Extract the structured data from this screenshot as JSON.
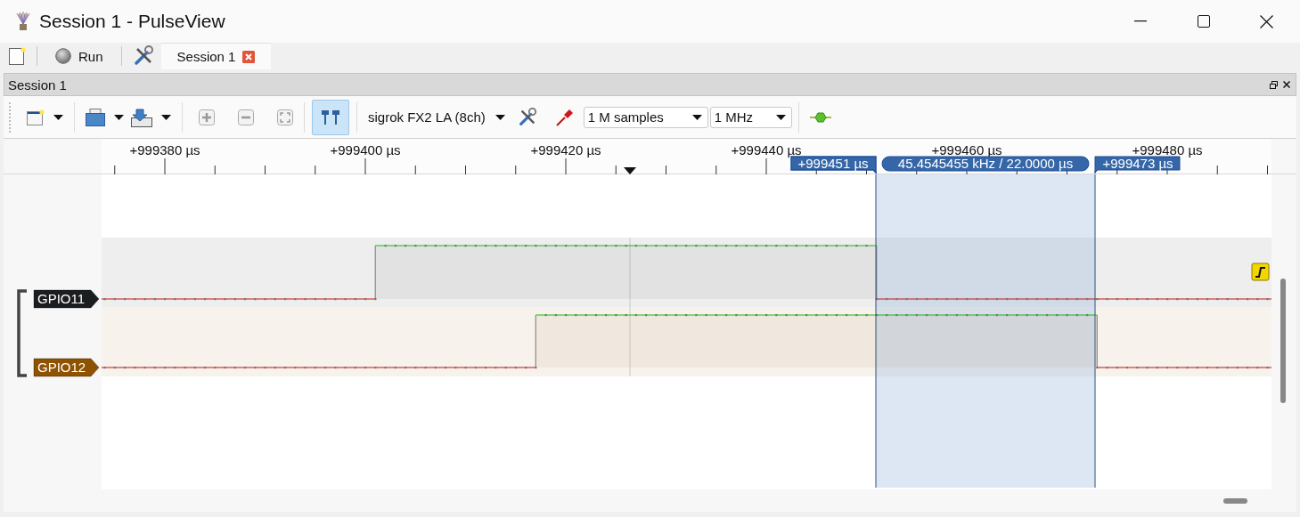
{
  "window": {
    "title": "Session 1 - PulseView"
  },
  "main_toolbar": {
    "run_button": "Run",
    "tabs": [
      {
        "label": "Session 1",
        "selected": true
      }
    ]
  },
  "dock": {
    "title": "Session 1"
  },
  "toolbar": {
    "cursors_button": {
      "on": true
    },
    "device": "sigrok FX2 LA (8ch)",
    "samples": "1 M samples",
    "samplerate": "1 MHz"
  },
  "ruler": {
    "labels": [
      "+999380 µs",
      "+999400 µs",
      "+999420 µs",
      "+999440 µs",
      "+999460 µs",
      "+999480 µs"
    ]
  },
  "cursors": [
    {
      "label": "+999451 µs"
    },
    {
      "label": "+999473 µs"
    }
  ],
  "cursor_measurement": "45.4545455 kHz / 22.0000 µs",
  "signals": [
    {
      "name": "GPIO11",
      "color": "#1b1e20"
    },
    {
      "name": "GPIO12",
      "color": "#8f5200"
    }
  ]
}
